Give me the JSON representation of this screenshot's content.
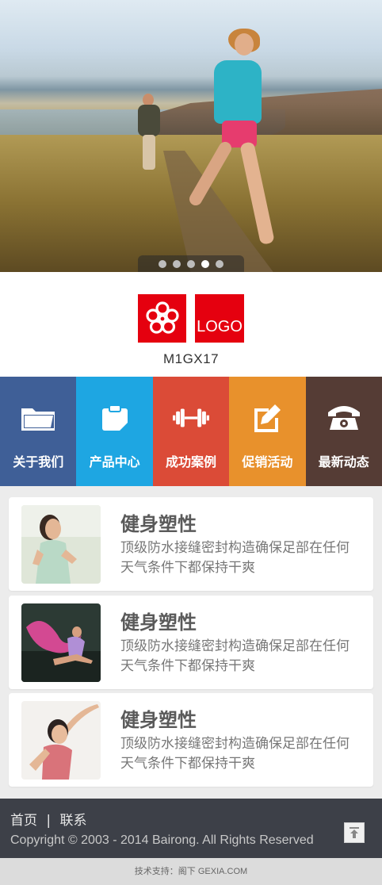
{
  "hero": {
    "slide_count": 5,
    "active_slide": 4
  },
  "brand": {
    "logo_text": "LOGO",
    "site_name": "M1GX17",
    "color": "#e5000f"
  },
  "nav": [
    {
      "label": "关于我们",
      "icon": "folder-icon",
      "color": "#3f5f97"
    },
    {
      "label": "产品中心",
      "icon": "clipboard-icon",
      "color": "#1ea6e2"
    },
    {
      "label": "成功案例",
      "icon": "dumbbell-icon",
      "color": "#db4b37"
    },
    {
      "label": "促销活动",
      "icon": "edit-icon",
      "color": "#e8912c"
    },
    {
      "label": "最新动态",
      "icon": "phone-icon",
      "color": "#553c35"
    }
  ],
  "cards": [
    {
      "title": "健身塑性",
      "desc": "顶级防水接缝密封构造确保足部在任何天气条件下都保持干爽",
      "image": "yoga-woman"
    },
    {
      "title": "健身塑性",
      "desc": "顶级防水接缝密封构造确保足部在任何天气条件下都保持干爽",
      "image": "dancer-pink-silk"
    },
    {
      "title": "健身塑性",
      "desc": "顶级防水接缝密封构造确保足部在任何天气条件下都保持干爽",
      "image": "stretching-woman"
    }
  ],
  "footer": {
    "home_label": "首页",
    "separator": "|",
    "contact_label": "联系",
    "copyright": "Copyright © 2003 - 2014 Bairong. All Rights Reserved"
  },
  "support": {
    "text": "技术支持：阁下 GEXIA.COM"
  }
}
